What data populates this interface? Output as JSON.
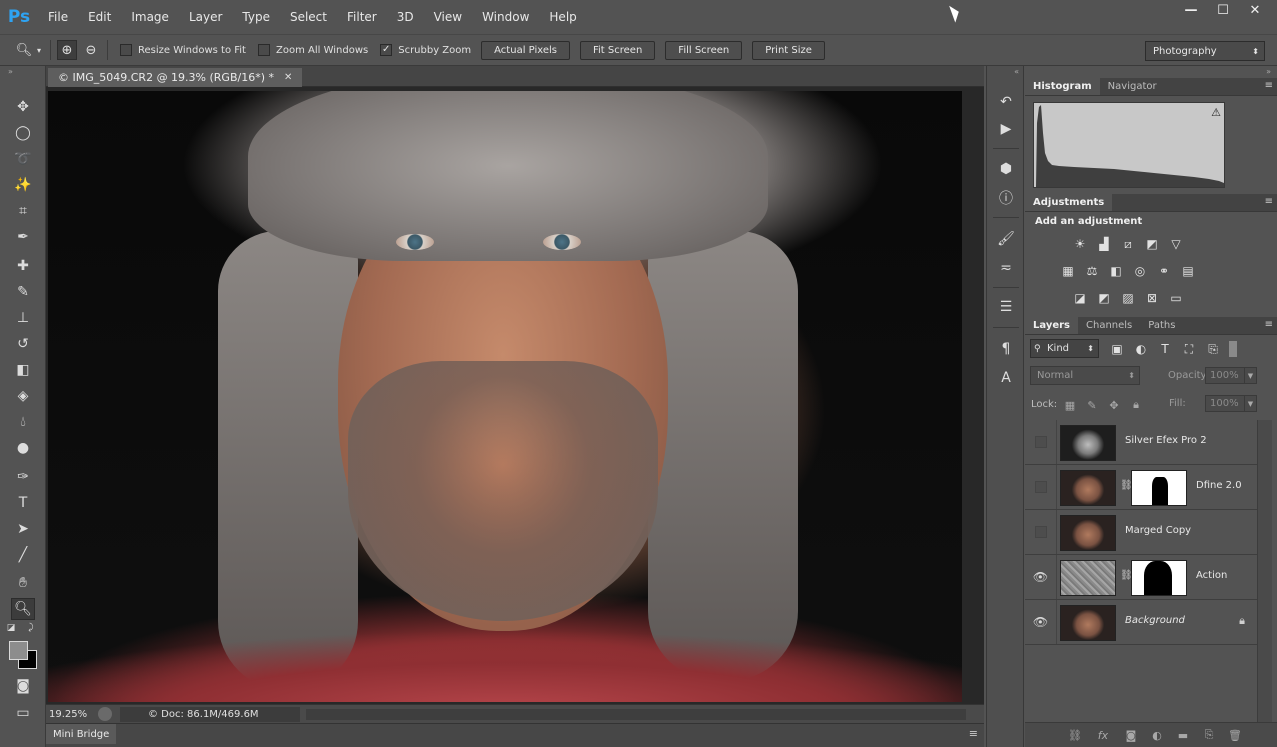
{
  "app": {
    "logo": "Ps",
    "menu": [
      "File",
      "Edit",
      "Image",
      "Layer",
      "Type",
      "Select",
      "Filter",
      "3D",
      "View",
      "Window",
      "Help"
    ],
    "window_controls": {
      "minimize": "—",
      "maximize": "☐",
      "close": "✕"
    }
  },
  "options_bar": {
    "checkboxes": [
      {
        "label": "Resize Windows to Fit",
        "checked": false
      },
      {
        "label": "Zoom All Windows",
        "checked": false
      },
      {
        "label": "Scrubby Zoom",
        "checked": true
      }
    ],
    "buttons": [
      "Actual Pixels",
      "Fit Screen",
      "Fill Screen",
      "Print Size"
    ],
    "workspace": "Photography"
  },
  "document": {
    "tab_title": "© IMG_5049.CR2 @ 19.3% (RGB/16*) *",
    "zoom": "19.25%",
    "doc_size": "© Doc: 86.1M/469.6M"
  },
  "mini_bridge": {
    "label": "Mini Bridge"
  },
  "histogram_panel": {
    "tabs": [
      "Histogram",
      "Navigator"
    ],
    "active": "Histogram"
  },
  "adjustments_panel": {
    "tab": "Adjustments",
    "title": "Add an adjustment"
  },
  "layers_panel": {
    "tabs": [
      "Layers",
      "Channels",
      "Paths"
    ],
    "active": "Layers",
    "filter_kind": "Kind",
    "blend_mode": "Normal",
    "opacity_label": "Opacity:",
    "opacity_value": "100%",
    "lock_label": "Lock:",
    "fill_label": "Fill:",
    "fill_value": "100%",
    "layers": [
      {
        "name": "Silver Efex Pro 2",
        "visible": false,
        "has_mask": false,
        "italic": false
      },
      {
        "name": "Dfine 2.0",
        "visible": false,
        "has_mask": true,
        "italic": false
      },
      {
        "name": "Marged Copy",
        "visible": false,
        "has_mask": false,
        "italic": false
      },
      {
        "name": "Action",
        "visible": true,
        "has_mask": true,
        "italic": false
      },
      {
        "name": "Background",
        "visible": true,
        "has_mask": false,
        "italic": true,
        "locked": true
      }
    ]
  },
  "colors": {
    "interface_bg": "#535353",
    "panel_dark": "#434343",
    "ps_blue": "#2ea3f2",
    "foreground_swatch": "#8d8d8d",
    "background_swatch": "#000000"
  }
}
